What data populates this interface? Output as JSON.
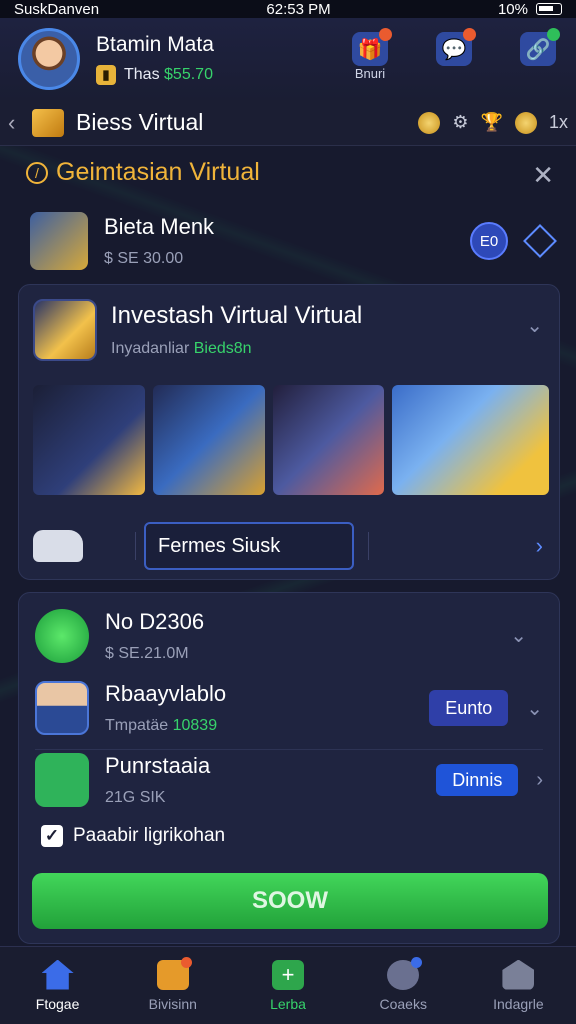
{
  "status_bar": {
    "carrier": "SuskDanven",
    "time": "62:53 PM",
    "battery": "10%"
  },
  "header": {
    "username": "Btamin Mata",
    "balance_label": "Thas",
    "balance_value": "$55.70",
    "icons": [
      {
        "name": "gift-icon",
        "label": "Bnuri"
      },
      {
        "name": "chat-icon",
        "label": ""
      },
      {
        "name": "link-icon",
        "label": ""
      }
    ]
  },
  "nav": {
    "title": "Biess Virtual",
    "right_text": "1x"
  },
  "panel": {
    "title": "Geimtasian Virtual",
    "item": {
      "title": "Bieta Menk",
      "sub": "$ SE 30.00",
      "button": "E0"
    }
  },
  "investment": {
    "title": "Investash Virtual Virtual",
    "sub_label": "Inyadanliar",
    "sub_value": "Bieds8n",
    "input_value": "Fermes Siusk"
  },
  "list": {
    "rows": [
      {
        "title": "No D2306",
        "sub": "$ SE.21.0M"
      },
      {
        "title": "Rbaayvlablo",
        "sub_label": "Tmpatäe",
        "sub_value": "10839",
        "button": "Eunto"
      },
      {
        "title": "Punrstaaia",
        "sub": "21G SIK",
        "button": "Dinnis"
      }
    ],
    "checkbox_label": "Paaabir ligrikohan",
    "checkbox_checked": true,
    "cta": "SOOW"
  },
  "tabbar": [
    {
      "label": "Ftogae",
      "icon": "home-icon",
      "active": true
    },
    {
      "label": "Bivisinn",
      "icon": "shop-icon",
      "active": false
    },
    {
      "label": "Lerba",
      "icon": "plus-icon",
      "active": false
    },
    {
      "label": "Coaeks",
      "icon": "settings-icon",
      "active": false
    },
    {
      "label": "Indagrle",
      "icon": "bank-icon",
      "active": false
    }
  ]
}
